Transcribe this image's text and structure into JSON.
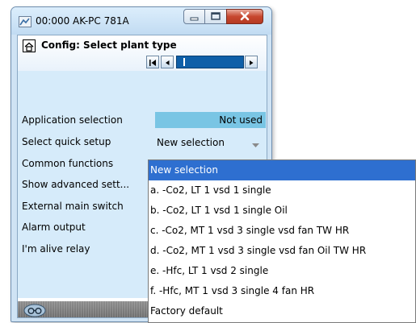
{
  "window": {
    "title": "00:000 AK-PC 781A",
    "icon": "network-icon",
    "buttons": [
      "minimize-icon",
      "maximize-icon",
      "close-icon"
    ]
  },
  "screen": {
    "title": "Config: Select plant type",
    "home_icon": "home-icon",
    "nav_icons": [
      "first-page-icon",
      "previous-page-icon",
      "next-page-icon"
    ]
  },
  "settings": {
    "application_selection": {
      "label": "Application selection",
      "value": "Not used"
    },
    "select_quick_setup": {
      "label": "Select quick setup",
      "value": "New selection"
    },
    "common_functions": {
      "label": "Common functions"
    },
    "show_advanced_settings": {
      "label": "Show advanced sett..."
    },
    "external_main_switch": {
      "label": "External main switch"
    },
    "alarm_output": {
      "label": "Alarm output"
    },
    "im_alive_relay": {
      "label": "I'm alive relay"
    }
  },
  "dropdown": {
    "options": [
      "New selection",
      "a. -Co2, LT 1 vsd 1 single",
      "b. -Co2, LT 1 vsd 1 single Oil",
      "c. -Co2, MT 1 vsd 3 single vsd fan TW HR",
      "d. -Co2, MT 1 vsd 3 single vsd fan Oil TW HR",
      "e. -Hfc, LT 1 vsd 2 single",
      "f. -Hfc, MT 1 vsd 3 single 4 fan HR",
      "Factory default"
    ],
    "selected_index": 0
  },
  "statusbar": {
    "icon": "glasses-icon"
  },
  "colors": {
    "selection": "#2e6fd0",
    "value_highlight": "#79c5e4",
    "nav_field": "#0e5fa8",
    "client_bg": "#d6ebfa"
  }
}
